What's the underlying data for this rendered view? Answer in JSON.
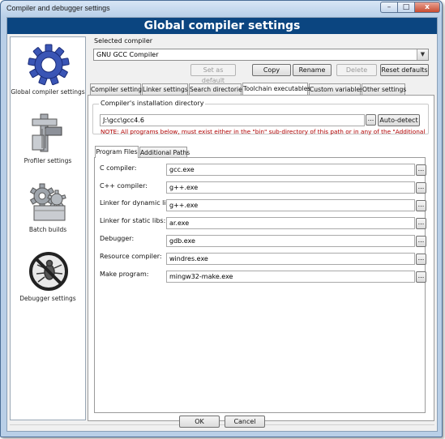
{
  "window": {
    "title": "Compiler and debugger settings",
    "controls": {
      "minimize": "–",
      "maximize": "□",
      "close": "x"
    }
  },
  "header": {
    "title": "Global compiler settings"
  },
  "sidebar": {
    "items": [
      {
        "label": "Global compiler settings",
        "icon": "gear-icon",
        "selected": true
      },
      {
        "label": "Profiler settings",
        "icon": "caliper-icon",
        "selected": false
      },
      {
        "label": "Batch builds",
        "icon": "gears-box-icon",
        "selected": false
      },
      {
        "label": "Debugger settings",
        "icon": "bug-prohibited-icon",
        "selected": false
      }
    ]
  },
  "compiler": {
    "selected_label": "Selected compiler",
    "selected_value": "GNU GCC Compiler",
    "buttons": {
      "set_default": "Set as default",
      "copy": "Copy",
      "rename": "Rename",
      "delete": "Delete",
      "reset": "Reset defaults"
    }
  },
  "tabs": [
    {
      "label": "Compiler settings",
      "active": false
    },
    {
      "label": "Linker settings",
      "active": false
    },
    {
      "label": "Search directories",
      "active": false
    },
    {
      "label": "Toolchain executables",
      "active": true
    },
    {
      "label": "Custom variables",
      "active": false
    },
    {
      "label": "Other settings",
      "active": false
    }
  ],
  "install": {
    "group_label": "Compiler's installation directory",
    "path": "J:\\gcc\\gcc4.6",
    "browse": "...",
    "autodetect": "Auto-detect",
    "note": "NOTE: All programs below, must exist either in the \"bin\" sub-directory of this path or in any of the \"Additional"
  },
  "subtabs": [
    {
      "label": "Program Files",
      "active": true
    },
    {
      "label": "Additional Paths",
      "active": false
    }
  ],
  "programs": [
    {
      "label": "C compiler:",
      "value": "gcc.exe"
    },
    {
      "label": "C++ compiler:",
      "value": "g++.exe"
    },
    {
      "label": "Linker for dynamic libs:",
      "value": "g++.exe"
    },
    {
      "label": "Linker for static libs:",
      "value": "ar.exe"
    },
    {
      "label": "Debugger:",
      "value": "gdb.exe"
    },
    {
      "label": "Resource compiler:",
      "value": "windres.exe"
    },
    {
      "label": "Make program:",
      "value": "mingw32-make.exe"
    }
  ],
  "browse_label": "...",
  "footer": {
    "ok": "OK",
    "cancel": "Cancel"
  },
  "colors": {
    "header_band": "#0b4580",
    "note_text": "#b00000",
    "window_frame": "#b9cfe7"
  }
}
